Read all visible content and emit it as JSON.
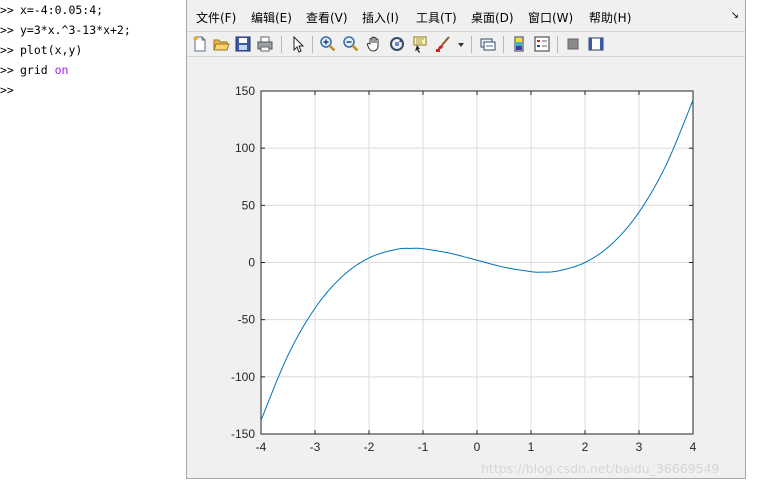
{
  "command_window": {
    "prompt": ">>",
    "lines": [
      {
        "code": "x=-4:0.05:4;"
      },
      {
        "code": "y=3*x.^3-13*x+2;"
      },
      {
        "code": "plot(x,y)"
      },
      {
        "code": "grid ",
        "keyword": "on"
      }
    ]
  },
  "figure": {
    "menu": [
      "文件(F)",
      "编辑(E)",
      "查看(V)",
      "插入(I)",
      "工具(T)",
      "桌面(D)",
      "窗口(W)",
      "帮助(H)"
    ],
    "menu_overflow_glyph": "↘",
    "toolbar_icons": [
      "new-figure-icon",
      "open-file-icon",
      "save-icon",
      "print-icon",
      "edit-plot-arrow-icon",
      "zoom-in-icon",
      "zoom-out-icon",
      "pan-hand-icon",
      "rotate-3d-icon",
      "data-cursor-icon",
      "brush-icon",
      "brush-dropdown-icon",
      "link-plot-icon",
      "insert-colorbar-icon",
      "insert-legend-icon",
      "hide-plot-tools-icon",
      "show-plot-tools-icon"
    ],
    "colors": {
      "line": "#0072bd",
      "grid": "#dcdcdc",
      "axes": "#262626",
      "figure_bg": "#f0f0f0",
      "keyword": "#a020f0"
    }
  },
  "chart_data": {
    "type": "line",
    "title": "",
    "xlabel": "",
    "ylabel": "",
    "xlim": [
      -4,
      4
    ],
    "ylim": [
      -150,
      150
    ],
    "xticks": [
      -4,
      -3,
      -2,
      -1,
      0,
      1,
      2,
      3,
      4
    ],
    "yticks": [
      -150,
      -100,
      -50,
      0,
      50,
      100,
      150
    ],
    "grid": true,
    "series": [
      {
        "x": [
          -4,
          -3.5,
          -3,
          -2.5,
          -2,
          -1.5,
          -1.2,
          -1,
          -0.5,
          0,
          0.5,
          1,
          1.2,
          1.5,
          2,
          2.5,
          3,
          3.5,
          4
        ],
        "y": [
          -138,
          -81.1,
          -40,
          -12.4,
          4,
          11.4,
          12.4,
          12,
          8.1,
          2,
          -4.1,
          -8,
          -8.4,
          -7.4,
          0,
          16.4,
          44,
          85.1,
          142
        ]
      }
    ]
  },
  "watermark": "https://blog.csdn.net/baidu_36669549"
}
